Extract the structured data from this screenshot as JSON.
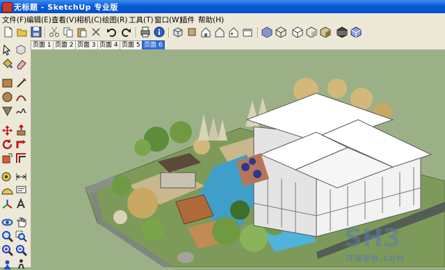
{
  "window": {
    "title": "无标题 - SketchUp 专业版"
  },
  "menu": [
    "文件(F)",
    "编辑(E)",
    "查看(V)",
    "相机(C)",
    "绘图(R)",
    "工具(T)",
    "窗口(W)",
    "插件",
    "帮助(H)"
  ],
  "toolbar": {
    "buttons": [
      "new-icon",
      "open-icon",
      "save-icon",
      "cut-icon",
      "copy-icon",
      "paste-icon",
      "erase-icon",
      "undo-icon",
      "redo-icon",
      "print-icon",
      "model-info-icon",
      "iso-view-icon",
      "top-view-icon",
      "front-view-icon",
      "right-view-icon",
      "back-view-icon",
      "left-view-icon",
      "xray-icon",
      "wireframe-icon",
      "hidden-line-icon",
      "shaded-icon",
      "shaded-texture-icon",
      "monochrome-icon"
    ]
  },
  "scene_tabs": {
    "items": [
      "页面 1",
      "页面 2",
      "页面 3",
      "页面 4",
      "页面 5",
      "页面 6"
    ],
    "active_index": 5
  },
  "watermark": {
    "cn": "环保学社.COM"
  },
  "colors": {
    "title_bar": "#0a5bdc",
    "active_tab": "#2f6fd8",
    "viewport_bg": "#9cb087"
  }
}
